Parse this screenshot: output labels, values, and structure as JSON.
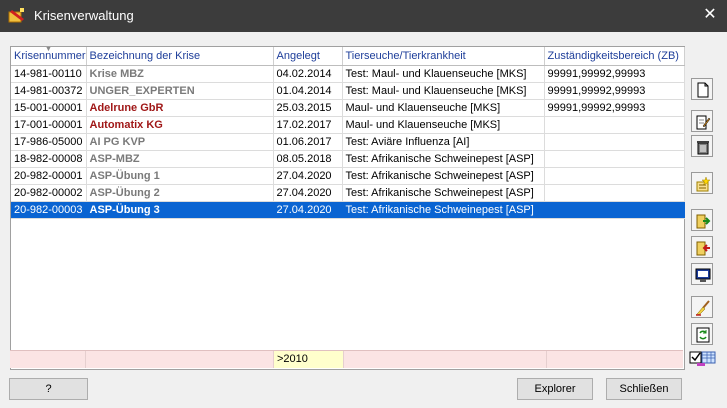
{
  "window": {
    "title": "Krisenverwaltung",
    "close_glyph": "✕"
  },
  "table": {
    "headers": [
      "Krisennummer",
      "Bezeichnung der Krise",
      "Angelegt",
      "Tierseuche/Tierkrankheit",
      "Zuständigkeitsbereich (ZB)"
    ],
    "rows": [
      {
        "nr": "14-981-00110",
        "name": "Krise MBZ",
        "name_color": "gray",
        "date": "04.02.2014",
        "disease": "Test: Maul- und Klauenseuche [MKS]",
        "zb": "99991,99992,99993"
      },
      {
        "nr": "14-981-00372",
        "name": "UNGER_EXPERTEN",
        "name_color": "gray",
        "date": "01.04.2014",
        "disease": "Test: Maul- und Klauenseuche [MKS]",
        "zb": "99991,99992,99993"
      },
      {
        "nr": "15-001-00001",
        "name": "Adelrune GbR",
        "name_color": "red",
        "date": "25.03.2015",
        "disease": "Maul- und Klauenseuche [MKS]",
        "zb": "99991,99992,99993"
      },
      {
        "nr": "17-001-00001",
        "name": "Automatix KG",
        "name_color": "red",
        "date": "17.02.2017",
        "disease": "Maul- und Klauenseuche [MKS]",
        "zb": ""
      },
      {
        "nr": "17-986-05000",
        "name": "AI PG KVP",
        "name_color": "gray",
        "date": "01.06.2017",
        "disease": "Test: Aviäre Influenza [AI]",
        "zb": ""
      },
      {
        "nr": "18-982-00008",
        "name": "ASP-MBZ",
        "name_color": "gray",
        "date": "08.05.2018",
        "disease": "Test: Afrikanische Schweinepest [ASP]",
        "zb": ""
      },
      {
        "nr": "20-982-00001",
        "name": "ASP-Übung 1",
        "name_color": "gray",
        "date": "27.04.2020",
        "disease": "Test: Afrikanische Schweinepest [ASP]",
        "zb": ""
      },
      {
        "nr": "20-982-00002",
        "name": "ASP-Übung 2",
        "name_color": "gray",
        "date": "27.04.2020",
        "disease": "Test: Afrikanische Schweinepest [ASP]",
        "zb": ""
      },
      {
        "nr": "20-982-00003",
        "name": "ASP-Übung 3",
        "name_color": "gray",
        "date": "27.04.2020",
        "disease": "Test: Afrikanische Schweinepest [ASP]",
        "zb": "",
        "selected": true
      }
    ]
  },
  "filter": {
    "date": ">2010"
  },
  "side_icons": [
    "new-document-icon",
    "edit-document-icon",
    "trash-icon",
    "add-star-icon",
    "export-icon",
    "import-icon",
    "screen-icon",
    "brush-icon",
    "refresh-icon"
  ],
  "buttons": {
    "help": "?",
    "explorer": "Explorer",
    "close": "Schließen"
  },
  "colors": {
    "selection": "#0a64d2",
    "header_text": "#1e3e9a",
    "red_name": "#a01818",
    "gray_name": "#7a7a7a",
    "filter_bg": "#fbe4e4",
    "filter_date_bg": "#ffffcc"
  }
}
